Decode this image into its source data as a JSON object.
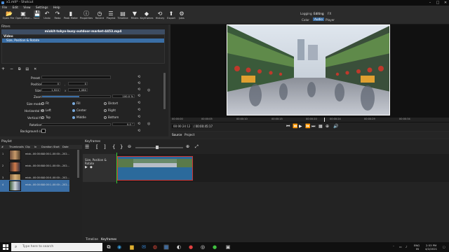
{
  "window": {
    "title": "x1.mlt* - Shotcut"
  },
  "menu": [
    "File",
    "Edit",
    "View",
    "Settings",
    "Help"
  ],
  "toolbar": [
    "Open File",
    "Open Other...",
    "Save",
    "Undo",
    "Redo",
    "Peak Meter",
    "Properties",
    "Recent",
    "Playlist",
    "Timeline",
    "Filters",
    "Keyframes",
    "History",
    "Export",
    "Jobs"
  ],
  "layouts": {
    "logging": "Logging",
    "editing": "Editing",
    "fx": "FX",
    "color": "Color",
    "audio": "Audio",
    "player": "Player"
  },
  "filters": {
    "title": "Filters",
    "clip_name": "mixkit-tokyo-busy-outdoor-market-4453.mp4",
    "list_header": "Video",
    "filter_item": "Size, Position & Rotate",
    "props": {
      "preset": "Preset",
      "position": "Position",
      "pos_x": "0",
      "pos_y": "0",
      "size": "Size",
      "size_w": "1,920",
      "size_h": "1,080",
      "zoom": "Zoom",
      "zoom_val": "100.0 %",
      "zoom_pct": 0.55,
      "size_mode": "Size mode",
      "fit": "Fit",
      "fill": "Fill",
      "distort": "Distort",
      "hfit": "Horizontal fit",
      "left": "Left",
      "center": "Center",
      "right": "Right",
      "vfit": "Vertical fit",
      "top": "Top",
      "middle": "Middle",
      "bottom": "Bottom",
      "rotation": "Rotation",
      "rotation_val": "0.0 °",
      "bgcolor": "Background color"
    }
  },
  "ruler": [
    "00:00:00",
    "00:00:05",
    "00:00:10",
    "00:00:15",
    "00:00:20",
    "00:00:24",
    "00:00:29",
    "00:00:34"
  ],
  "transport": {
    "current": "00:00:24:12",
    "total": "/ 00:00:45:17"
  },
  "src_tabs": {
    "source": "Source",
    "project": "Project"
  },
  "playlist": {
    "title": "Playlist",
    "headers": [
      "#",
      "Thumbnails",
      "Clip",
      "In",
      "Duration",
      "Start",
      "Date"
    ],
    "rows": [
      {
        "num": "1",
        "clip": "mixk...",
        "in": "00:00:0...",
        "dur": "00:00:1...",
        "start": "00:00:...",
        "date": "202..."
      },
      {
        "num": "2",
        "clip": "mixk...",
        "in": "00:00:0...",
        "dur": "00:00:1...",
        "start": "00:00:...",
        "date": "202..."
      },
      {
        "num": "3",
        "clip": "mixk...",
        "in": "00:00:0...",
        "dur": "00:00:0...",
        "start": "00:00:...",
        "date": "202..."
      },
      {
        "num": "4",
        "clip": "mixk...",
        "in": "00:00:0...",
        "dur": "00:00:1...",
        "start": "00:00:...",
        "date": "202..."
      }
    ]
  },
  "timeline": {
    "title": "Keyframes",
    "track": "Size, Position & Rotate",
    "tab_timeline": "Timeline",
    "tab_keyframes": "Keyframes"
  },
  "taskbar": {
    "search": "Type here to search",
    "lang": "ENG",
    "lang2": "IN",
    "time": "2:53 PM",
    "date": "4/2/2021"
  }
}
